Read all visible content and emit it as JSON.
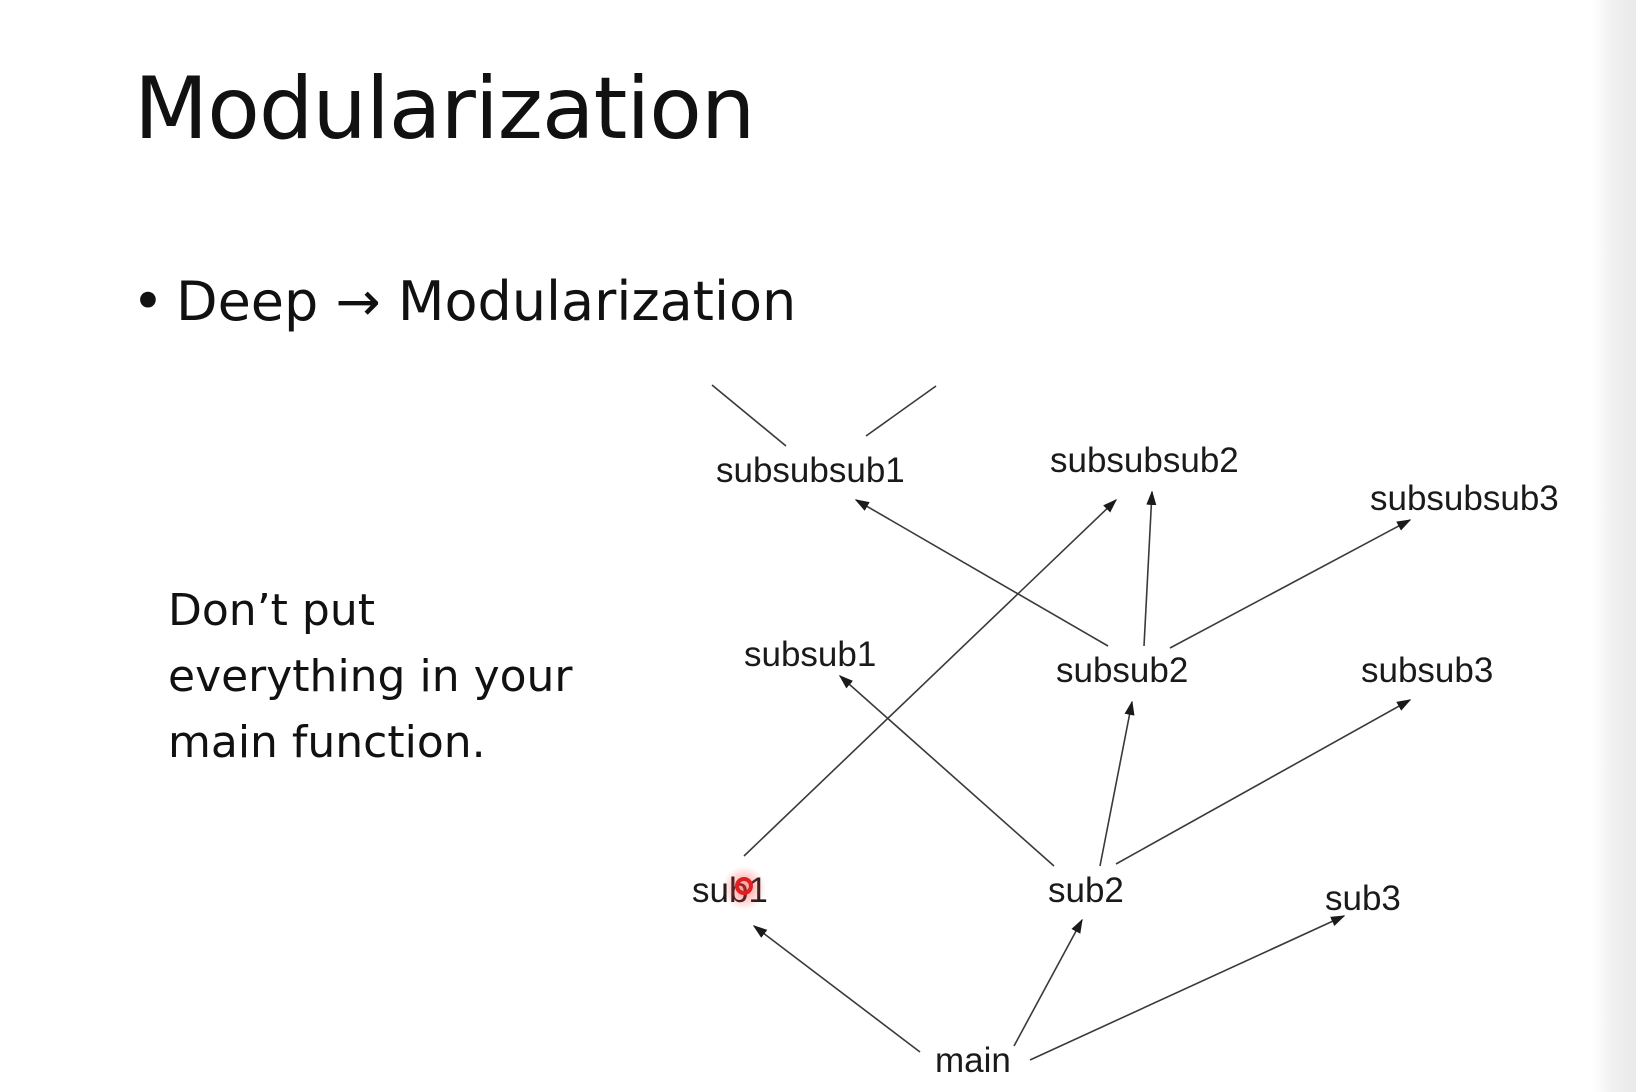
{
  "slide": {
    "title": "Modularization",
    "bullet": {
      "left": "Deep",
      "arrow": "→",
      "right": "Modularization"
    },
    "body_lines": [
      "Don’t put",
      "everything in your",
      "main function."
    ]
  },
  "diagram": {
    "nodes": [
      {
        "id": "subsubsub1",
        "label": "subsubsub1"
      },
      {
        "id": "subsubsub2",
        "label": "subsubsub2"
      },
      {
        "id": "subsubsub3",
        "label": "subsubsub3"
      },
      {
        "id": "subsub1",
        "label": "subsub1"
      },
      {
        "id": "subsub2",
        "label": "subsub2"
      },
      {
        "id": "subsub3",
        "label": "subsub3"
      },
      {
        "id": "sub1",
        "label": "sub1"
      },
      {
        "id": "sub2",
        "label": "sub2"
      },
      {
        "id": "sub3",
        "label": "sub3"
      },
      {
        "id": "main",
        "label": "main"
      }
    ],
    "edges": [
      {
        "from": "main",
        "to": "sub1"
      },
      {
        "from": "main",
        "to": "sub2"
      },
      {
        "from": "main",
        "to": "sub3"
      },
      {
        "from": "sub1",
        "to": "subsubsub2"
      },
      {
        "from": "sub2",
        "to": "subsub1"
      },
      {
        "from": "sub2",
        "to": "subsub2"
      },
      {
        "from": "sub2",
        "to": "subsub3"
      },
      {
        "from": "subsub2",
        "to": "subsubsub1"
      },
      {
        "from": "subsub2",
        "to": "subsubsub2"
      },
      {
        "from": "subsub2",
        "to": "subsubsub3"
      }
    ],
    "cursor_color": "#e02020"
  }
}
